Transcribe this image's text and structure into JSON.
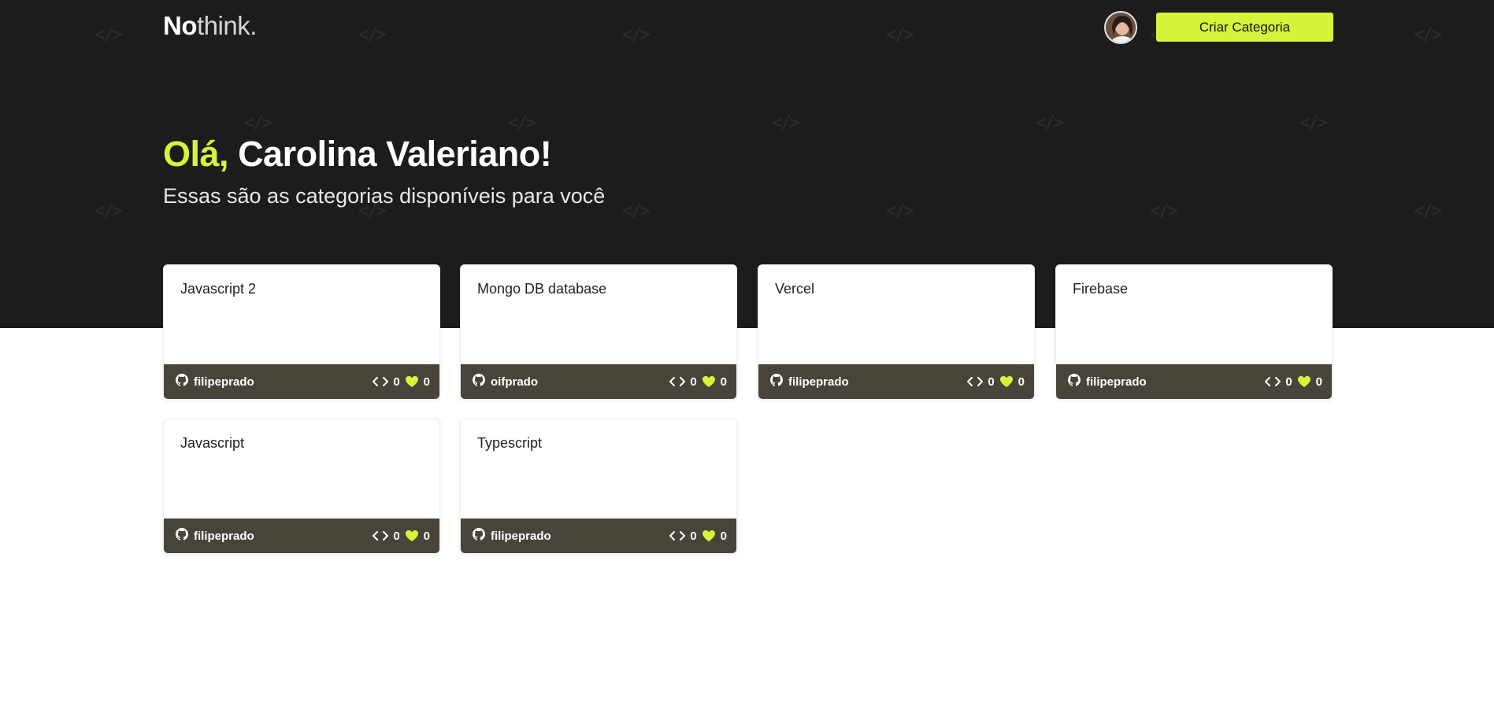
{
  "header": {
    "logo_main": "No",
    "logo_rest": "think.",
    "create_button_label": "Criar Categoria"
  },
  "hero": {
    "greeting_prefix": "Olá,",
    "user_name": "Carolina Valeriano!",
    "subtitle": "Essas são as categorias disponíveis para você"
  },
  "colors": {
    "accent": "#d4f53a",
    "hero_bg": "#1c1c1c",
    "card_footer": "#48443a"
  },
  "categories": [
    {
      "title": "Javascript 2",
      "author": "filipeprado",
      "code_count": "0",
      "likes": "0"
    },
    {
      "title": "Mongo DB database",
      "author": "oifprado",
      "code_count": "0",
      "likes": "0"
    },
    {
      "title": "Vercel",
      "author": "filipeprado",
      "code_count": "0",
      "likes": "0"
    },
    {
      "title": "Firebase",
      "author": "filipeprado",
      "code_count": "0",
      "likes": "0"
    },
    {
      "title": "Javascript",
      "author": "filipeprado",
      "code_count": "0",
      "likes": "0"
    },
    {
      "title": "Typescript",
      "author": "filipeprado",
      "code_count": "0",
      "likes": "0"
    }
  ],
  "icons": {
    "author": "github-icon",
    "code": "code-icon",
    "likes": "heart-icon"
  }
}
